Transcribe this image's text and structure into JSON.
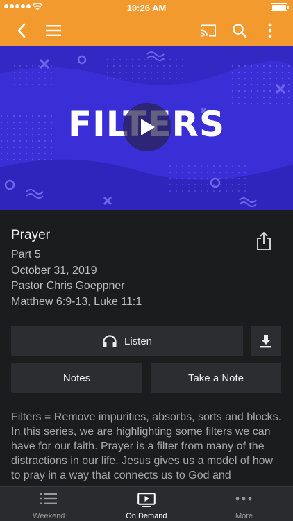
{
  "status_bar": {
    "time": "10:26 AM"
  },
  "nav": {
    "back_icon": "chevron-left-icon",
    "menu_icon": "hamburger-menu-icon",
    "cast_icon": "cast-icon",
    "search_icon": "search-icon",
    "more_icon": "vertical-dots-icon"
  },
  "video": {
    "title": "FILTERS",
    "play_icon": "play-icon"
  },
  "message": {
    "title": "Prayer",
    "part": "Part 5",
    "date": "October 31, 2019",
    "speaker": "Pastor Chris Goeppner",
    "scripture": "Matthew 6:9-13, Luke 11:1",
    "share_icon": "share-icon"
  },
  "actions": {
    "listen_label": "Listen",
    "listen_icon": "headphones-icon",
    "download_icon": "download-icon",
    "notes_label": "Notes",
    "take_note_label": "Take a Note"
  },
  "description": "Filters = Remove impurities, absorbs, sorts and blocks. In this series, we are highlighting some filters we can have for our faith. Prayer is a filter from many of the distractions in our life. Jesus gives us a model of how to pray in a way that connects us to God and",
  "tabs": [
    {
      "label": "Weekend",
      "icon": "list-icon",
      "active": false
    },
    {
      "label": "On Demand",
      "icon": "tv-play-icon",
      "active": true
    },
    {
      "label": "More",
      "icon": "horizontal-dots-icon",
      "active": false
    }
  ],
  "colors": {
    "accent": "#f39a2f",
    "video_background": "#3a2fd6",
    "page_background": "#1b1c1e",
    "button_background": "#2c2d30"
  }
}
